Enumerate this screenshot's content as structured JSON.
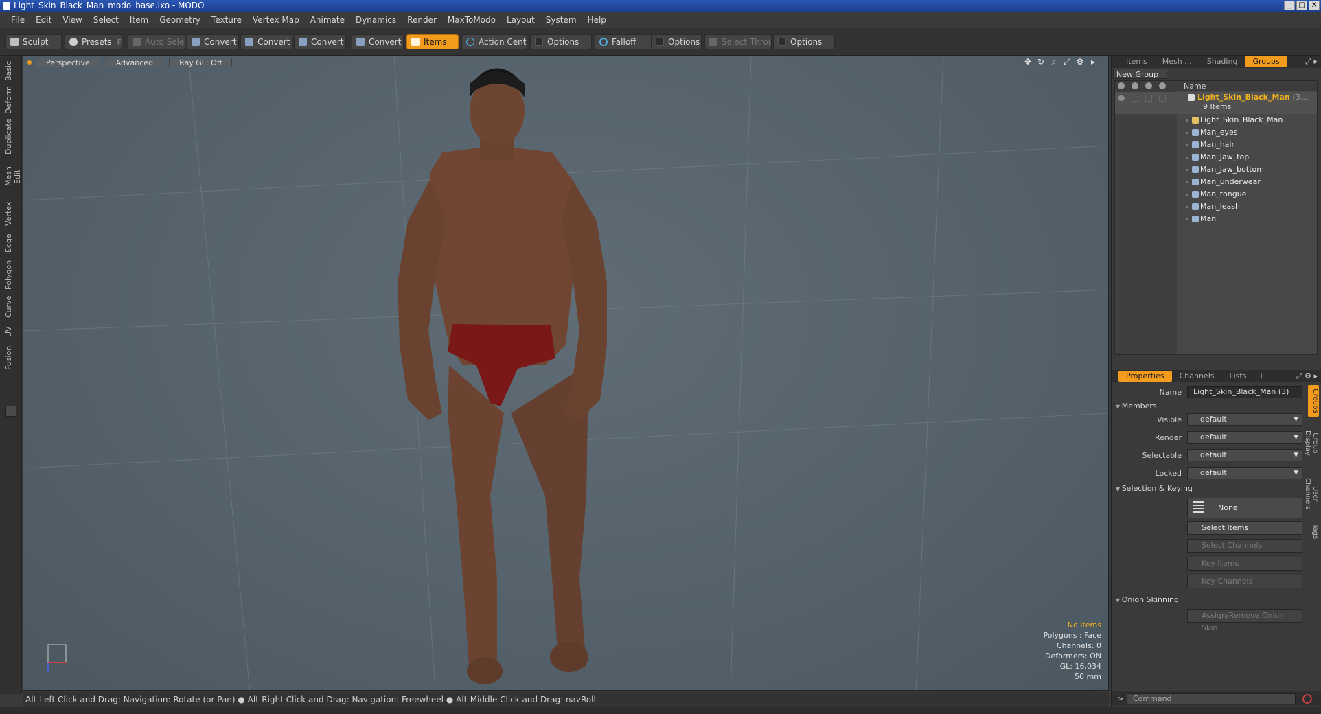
{
  "window": {
    "title": "Light_Skin_Black_Man_modo_base.lxo - MODO",
    "controls": [
      "_",
      "□",
      "X"
    ]
  },
  "menu": [
    "File",
    "Edit",
    "View",
    "Select",
    "Item",
    "Geometry",
    "Texture",
    "Vertex Map",
    "Animate",
    "Dynamics",
    "Render",
    "MaxToModo",
    "Layout",
    "System",
    "Help"
  ],
  "toolbar": {
    "sculpt": "Sculpt",
    "presets": "Presets",
    "presets_hint": "F6",
    "auto_select": "Auto Select",
    "convert1": "Convert",
    "convert2": "Convert",
    "convert3": "Convert",
    "convert4": "Convert",
    "items": "Items",
    "action_center": "Action Center",
    "options1": "Options",
    "falloff": "Falloff",
    "options2": "Options",
    "select_through": "Select Through",
    "options3": "Options"
  },
  "left_tabs": [
    "Basic",
    "Deform",
    "Duplicate",
    "Mesh Edit",
    "Vertex",
    "Edge",
    "Polygon",
    "Curve",
    "UV",
    "Fusion"
  ],
  "viewport": {
    "tabs": [
      "Perspective",
      "Advanced",
      "Ray GL: Off"
    ],
    "stats": {
      "selection": "No Items",
      "polygons": "Polygons : Face",
      "channels": "Channels: 0",
      "deformers": "Deformers: ON",
      "gl": "GL: 16,034",
      "focal": "50 mm"
    }
  },
  "status_bar": "Alt-Left Click and Drag: Navigation: Rotate (or Pan) ● Alt-Right Click and Drag: Navigation: Freewheel ● Alt-Middle Click and Drag: navRoll",
  "top_panel": {
    "tabs": [
      "Items",
      "Mesh ...",
      "Shading",
      "Groups"
    ],
    "active_tab": "Groups",
    "new_group": "New Group",
    "name_header": "Name",
    "group_name": "Light_Skin_Black_Man",
    "group_count": "(3...",
    "group_subtitle": "9 Items",
    "items": [
      "Light_Skin_Black_Man",
      "Man_eyes",
      "Man_hair",
      "Man_Jaw_top",
      "Man_Jaw_bottom",
      "Man_underwear",
      "Man_tongue",
      "Man_leash",
      "Man"
    ]
  },
  "properties": {
    "tabs": [
      "Properties",
      "Channels",
      "Lists",
      "+"
    ],
    "name_label": "Name",
    "name_value": "Light_Skin_Black_Man (3)",
    "members_section": "Members",
    "visible_label": "Visible",
    "visible_value": "default",
    "render_label": "Render",
    "render_value": "default",
    "selectable_label": "Selectable",
    "selectable_value": "default",
    "locked_label": "Locked",
    "locked_value": "default",
    "selection_section": "Selection & Keying",
    "none_button": "None",
    "select_items": "Select Items",
    "select_channels": "Select Channels",
    "key_items": "Key Items",
    "key_channels": "Key Channels",
    "onion_section": "Onion Skinning",
    "assign_onion": "Assign/Remove Onion Skin ..."
  },
  "side_tabs": [
    "Groups",
    "Group Display",
    "User Channels",
    "Tags"
  ],
  "command": {
    "prompt": ">",
    "placeholder": "Command"
  },
  "colors": {
    "accent": "#f29b1d",
    "skin": "#6b4330",
    "underwear": "#7a1818",
    "viewport_bg": "#5a6770"
  }
}
